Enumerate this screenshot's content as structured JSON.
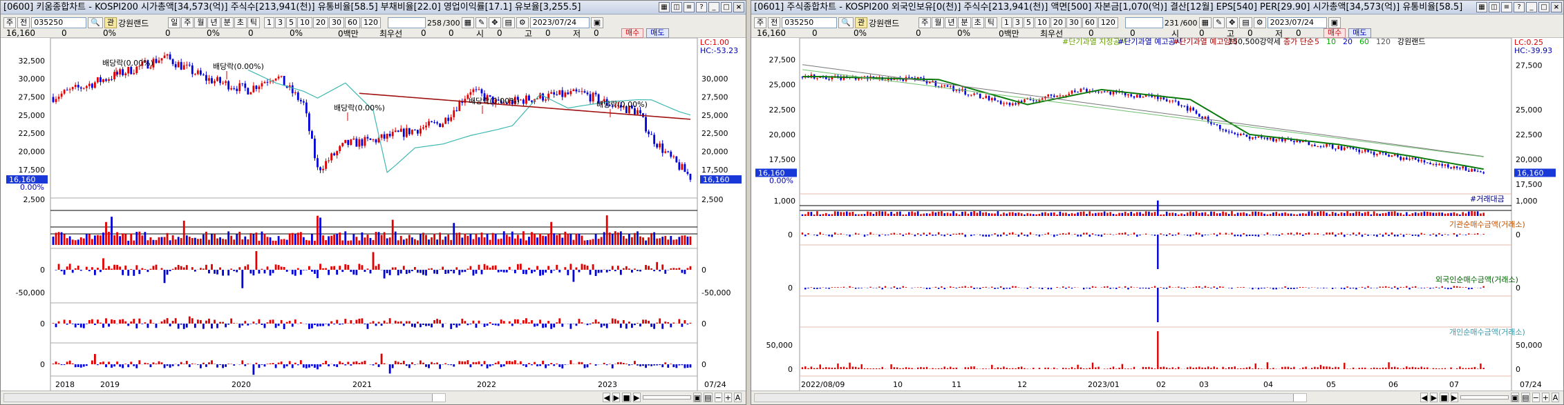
{
  "left": {
    "title": "[0600] 키움종합차트 - KOSPI200 시가총액[34,573(억)] 주식수[213,941(천)] 유통비율[58.5] 부채비율[22.0] 영업이익률[17.1] 유보율[3,255.5]",
    "code": "035250",
    "stock": "강원랜드",
    "periods": [
      "일",
      "주",
      "월",
      "년",
      "분",
      "초",
      "틱"
    ],
    "nums": [
      "1",
      "3",
      "5",
      "10",
      "20",
      "30",
      "60",
      "120"
    ],
    "page": "258",
    "page_total": "/300",
    "date": "2023/07/24",
    "type_a": "주",
    "type_b": "전",
    "quote": [
      "16,160",
      "0",
      "0%",
      "0",
      "0%",
      "0",
      "0%",
      "0백만",
      "최우선",
      "0",
      "0",
      "시",
      "0",
      "고",
      "0",
      "저",
      "0"
    ],
    "buy": "매수",
    "sell": "매도",
    "lc": "LC:1.00",
    "hc": "HC:-53.23",
    "price_left": "16,160",
    "pct_left": "0.00%",
    "price_right": "16,160",
    "y_labels": [
      "32,500",
      "30,000",
      "27,500",
      "25,000",
      "22,500",
      "20,000",
      "17,500"
    ],
    "y_labels_r": [
      "30,000",
      "27,500",
      "25,000",
      "22,500",
      "20,000",
      "17,500"
    ],
    "events": [
      "배당락(0.00%)",
      "배당락(0.00%)",
      "배당락(0.00%)",
      "배당락(0.00%)",
      "배당락(0.00%)"
    ],
    "vol_label": "2,500",
    "sub1_labels": [
      "0",
      "-50,000"
    ],
    "sub2_label": "0",
    "sub3_label": "0",
    "x_labels": [
      "2018",
      "2019",
      "2020",
      "2021",
      "2022",
      "2023"
    ],
    "x_last": "07/24"
  },
  "right": {
    "title": "[0601] 주식종합차트 - KOSPI200 외국인보유[0(천)] 주식수[213,941(천)] 액면[500] 자본금[1,070(억)] 결산[12월] EPS[540] PER[29.90] 시가총액[34,573(억)] 유통비율[58.5]",
    "code": "035250",
    "stock": "강원랜드",
    "periods": [
      "주",
      "월",
      "년",
      "분",
      "초",
      "틱"
    ],
    "nums": [
      "1",
      "3",
      "5",
      "10",
      "20",
      "30",
      "60",
      "120"
    ],
    "page": "231",
    "page_total": "/600",
    "date": "2023/07/24",
    "type_a": "주",
    "type_b": "전",
    "quote": [
      "16,160",
      "0",
      "0%",
      "0",
      "0%",
      "0백만",
      "최우선",
      "0",
      "0",
      "시",
      "0",
      "고",
      "0",
      "저",
      "0"
    ],
    "buy": "매수",
    "sell": "매도",
    "legend": [
      "#단기과열 지정공시",
      "#단기과열 예고공시",
      "#단기과열 예고임박",
      "150,500강약세",
      "종가 단순",
      "5",
      "10",
      "20",
      "60",
      "120",
      "강원랜드"
    ],
    "lc": "LC:0.25",
    "hc": "HC:-39.93",
    "price_left": "16,160",
    "pct_left": "0.00%",
    "price_right": "16,160",
    "y_labels": [
      "27,500",
      "25,000",
      "22,500",
      "20,000",
      "17,500"
    ],
    "vol_label": "1,000",
    "vol_tag": "#거래대금",
    "inst_label": "기관순매수금액(거래소)",
    "foreign_label": "외국인순매수금액(거래소)",
    "indiv_label": "개인순매수금액(거래소)",
    "zero": "0",
    "indiv_max": "50,000",
    "x_labels": [
      "2022/08/09",
      "10",
      "11",
      "12",
      "2023/01",
      "02",
      "03",
      "04",
      "05",
      "06",
      "07"
    ],
    "x_last": "07/24"
  },
  "colors": {
    "up": "#e00000",
    "down": "#0000d8",
    "ma_cyan": "#3cb8b0",
    "ma_red": "#a01010",
    "ma_green": "#0a7a0a",
    "ma_gray": "#777777"
  }
}
